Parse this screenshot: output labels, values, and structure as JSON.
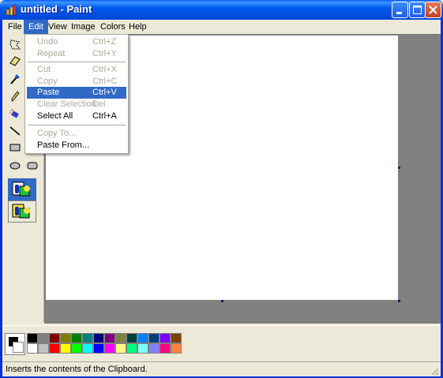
{
  "window": {
    "title": "untitled - Paint"
  },
  "menubar": {
    "items": [
      "File",
      "Edit",
      "View",
      "Image",
      "Colors",
      "Help"
    ],
    "active": "Edit"
  },
  "edit_menu": {
    "items": [
      {
        "label": "Undo",
        "shortcut": "Ctrl+Z",
        "enabled": false
      },
      {
        "label": "Repeat",
        "shortcut": "Ctrl+Y",
        "enabled": false
      },
      {
        "label": "Cut",
        "shortcut": "Ctrl+X",
        "enabled": false
      },
      {
        "label": "Copy",
        "shortcut": "Ctrl+C",
        "enabled": false
      },
      {
        "label": "Paste",
        "shortcut": "Ctrl+V",
        "enabled": true,
        "highlighted": true
      },
      {
        "label": "Clear Selection",
        "shortcut": "Del",
        "enabled": false
      },
      {
        "label": "Select All",
        "shortcut": "Ctrl+A",
        "enabled": true
      },
      {
        "label": "Copy To...",
        "shortcut": "",
        "enabled": false
      },
      {
        "label": "Paste From...",
        "shortcut": "",
        "enabled": true
      }
    ]
  },
  "tools": [
    "free-form-select-icon",
    "eraser-icon",
    "pick-color-icon",
    "pencil-icon",
    "airbrush-icon",
    "line-icon",
    "rectangle-icon",
    "ellipse-icon",
    "rounded-rectangle-icon"
  ],
  "colors": {
    "foreground": "#000000",
    "background": "#ffffff",
    "palette_top": [
      "#000000",
      "#808080",
      "#800000",
      "#808000",
      "#008000",
      "#008080",
      "#000080",
      "#800080",
      "#808040",
      "#004040",
      "#0080ff",
      "#004080",
      "#8000ff",
      "#804000"
    ],
    "palette_bottom": [
      "#ffffff",
      "#c0c0c0",
      "#ff0000",
      "#ffff00",
      "#00ff00",
      "#00ffff",
      "#0000ff",
      "#ff00ff",
      "#ffff80",
      "#00ff80",
      "#80ffff",
      "#8080ff",
      "#ff0080",
      "#ff8040"
    ]
  },
  "status": {
    "text": "Inserts the contents of the Clipboard."
  }
}
